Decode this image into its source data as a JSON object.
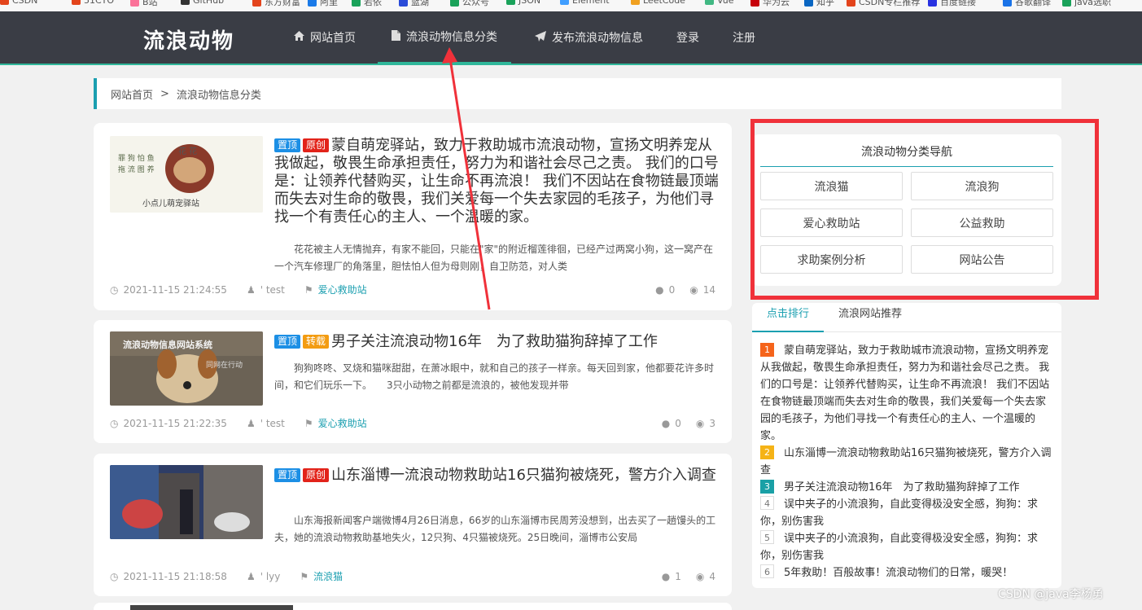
{
  "bookmarks": [
    {
      "label": "CSDN",
      "color": "#e3441c"
    },
    {
      "label": "51CTO",
      "color": "#e3441c"
    },
    {
      "label": "B站",
      "color": "#fb7299"
    },
    {
      "label": "GitHub",
      "color": "#333333"
    },
    {
      "label": "东方财富",
      "color": "#e3441c"
    },
    {
      "label": "阿里",
      "color": "#1a7ae8"
    },
    {
      "label": "若依",
      "color": "#1aa25a"
    },
    {
      "label": "蓝湖",
      "color": "#2a4bd8"
    },
    {
      "label": "公众号",
      "color": "#1aa25a"
    },
    {
      "label": "JSON",
      "color": "#1aa25a"
    },
    {
      "label": "Element",
      "color": "#409eff"
    },
    {
      "label": "LeetCode",
      "color": "#f0a020"
    },
    {
      "label": "Vue",
      "color": "#41b883"
    },
    {
      "label": "华为云",
      "color": "#c7000b"
    },
    {
      "label": "知乎",
      "color": "#0a66c2"
    },
    {
      "label": "CSDN专栏推荐",
      "color": "#e3441c"
    },
    {
      "label": "百度链接",
      "color": "#2932e1"
    },
    {
      "label": "谷歌翻译",
      "color": "#1a73e8"
    },
    {
      "label": "java选职",
      "color": "#1aa25a"
    }
  ],
  "header": {
    "logo": "流浪动物",
    "nav": [
      {
        "label": "网站首页",
        "icon": "home-icon"
      },
      {
        "label": "流浪动物信息分类",
        "icon": "document-icon",
        "active": true
      },
      {
        "label": "发布流浪动物信息",
        "icon": "paper-plane-icon"
      },
      {
        "label": "登录"
      },
      {
        "label": "注册"
      }
    ]
  },
  "breadcrumb": {
    "home": "网站首页",
    "separator": ">",
    "current": "流浪动物信息分类"
  },
  "posts": [
    {
      "tags": [
        "置顶",
        "原创"
      ],
      "title": "蒙自萌宠驿站，致力于救助城市流浪动物，宣扬文明养宠从我做起，敬畏生命承担责任，努力为和谐社会尽己之责。 我们的口号是：让领养代替购买，让生命不再流浪！ 我们不因站在食物链最顶端而失去对生命的敬畏，我们关爱每一个失去家园的毛孩子，为他们寻找一个有责任心的主人、一个温暖的家。",
      "excerpt": "花花被主人无情抛弃，有家不能回，只能在\"家\"的附近榴莲徘徊，已经产过两窝小狗，这一窝产在一个汽车修理厂的角落里，胆怯怕人但为母则刚，自卫防范，对人类",
      "date": "2021-11-15 21:24:55",
      "author": "' test",
      "category": "爱心救助站",
      "comments": "0",
      "views": "14"
    },
    {
      "tags": [
        "置顶",
        "转载"
      ],
      "title": "男子关注流浪动物16年　为了救助猫狗辞掉了工作",
      "excerpt": "狗狗咚咚、叉烧和猫咪甜甜，在萧冰眼中，就和自己的孩子一样亲。每天回到家，他都要花许多时间，和它们玩乐一下。　　3只小动物之前都是流浪的，被他发现并带",
      "date": "2021-11-15 21:22:35",
      "author": "' test",
      "category": "爱心救助站",
      "comments": "0",
      "views": "3"
    },
    {
      "tags": [
        "置顶",
        "原创"
      ],
      "title": "山东淄博一流浪动物救助站16只猫狗被烧死，警方介入调查",
      "excerpt": "山东海报新闻客户端微博4月26日消息，66岁的山东淄博市民周芳没想到，出去买了一趟馒头的工夫，她的流浪动物救助基地失火，12只狗、4只猫被烧死。25日晚间，淄博市公安局",
      "date": "2021-11-15 21:18:58",
      "author": "' lyy",
      "category": "流浪猫",
      "comments": "1",
      "views": "4"
    }
  ],
  "thumb_text": {
    "post1_caption": "小点儿萌宠驿站",
    "post2_title": "流浪动物信息网站系统",
    "post2_sub": "同网在行动"
  },
  "category_nav": {
    "title": "流浪动物分类导航",
    "items": [
      "流浪猫",
      "流浪狗",
      "爱心救助站",
      "公益救助",
      "求助案例分析",
      "网站公告"
    ]
  },
  "ranking": {
    "tabs": [
      "点击排行",
      "流浪网站推荐"
    ],
    "items": [
      {
        "num": "1",
        "text": "蒙自萌宠驿站，致力于救助城市流浪动物，宣扬文明养宠从我做起，敬畏生命承担责任，努力为和谐社会尽己之责。 我们的口号是：让领养代替购买，让生命不再流浪！ 我们不因站在食物链最顶端而失去对生命的敬畏，我们关爱每一个失去家园的毛孩子，为他们寻找一个有责任心的主人、一个温暖的家。"
      },
      {
        "num": "2",
        "text": "山东淄博一流浪动物救助站16只猫狗被烧死，警方介入调查"
      },
      {
        "num": "3",
        "text": "男子关注流浪动物16年　为了救助猫狗辞掉了工作"
      },
      {
        "num": "4",
        "text": "误中夹子的小流浪狗，自此变得极没安全感，狗狗：求你，别伤害我"
      },
      {
        "num": "5",
        "text": "误中夹子的小流浪狗，自此变得极没安全感，狗狗：求你，别伤害我"
      },
      {
        "num": "6",
        "text": "5年救助！百般故事！流浪动物们的日常，暖哭！"
      }
    ]
  },
  "watermark": "CSDN @java李杨勇",
  "colors": {
    "nav_bg": "#3a3d45",
    "accent": "#1b9fb0",
    "nav_underline": "#2fb79a",
    "highlight_box": "#f0313a",
    "arrow": "#f0313a"
  }
}
